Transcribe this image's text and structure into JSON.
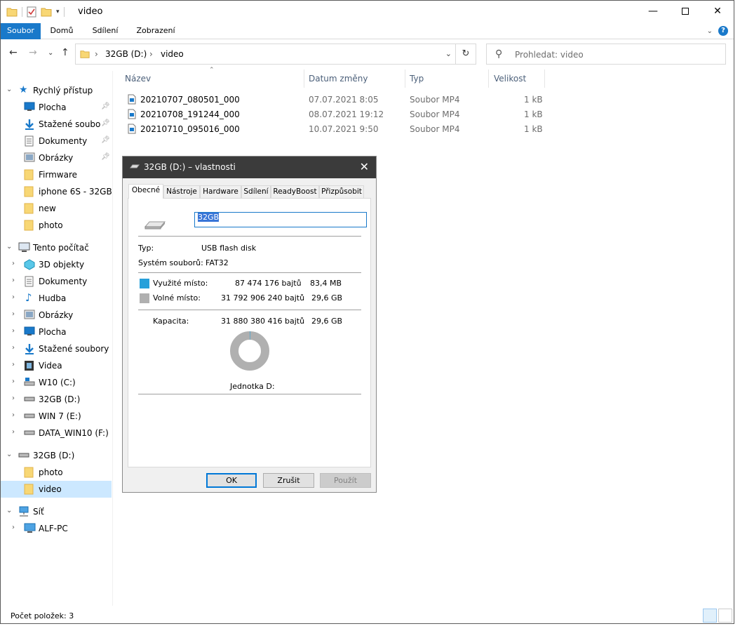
{
  "window": {
    "title": "video",
    "ribbon_tabs": [
      "Soubor",
      "Domů",
      "Sdílení",
      "Zobrazení"
    ]
  },
  "address": {
    "crumbs": [
      "32GB (D:)",
      "video"
    ]
  },
  "search": {
    "placeholder": "Prohledat: video"
  },
  "sidebar": {
    "quick_access": {
      "label": "Rychlý přístup",
      "items": [
        {
          "label": "Plocha",
          "icon": "desktop-icon",
          "pinned": true
        },
        {
          "label": "Stažené soubo",
          "icon": "download-icon",
          "pinned": true
        },
        {
          "label": "Dokumenty",
          "icon": "documents-icon",
          "pinned": true
        },
        {
          "label": "Obrázky",
          "icon": "pictures-icon",
          "pinned": true
        },
        {
          "label": "Firmware",
          "icon": "folder-icon",
          "pinned": false
        },
        {
          "label": "iphone 6S - 32GB",
          "icon": "folder-icon",
          "pinned": false
        },
        {
          "label": "new",
          "icon": "folder-icon",
          "pinned": false
        },
        {
          "label": "photo",
          "icon": "folder-icon",
          "pinned": false
        }
      ]
    },
    "this_pc": {
      "label": "Tento počítač",
      "items": [
        {
          "label": "3D objekty",
          "icon": "3d-objects-icon"
        },
        {
          "label": "Dokumenty",
          "icon": "documents-icon"
        },
        {
          "label": "Hudba",
          "icon": "music-icon"
        },
        {
          "label": "Obrázky",
          "icon": "pictures-icon"
        },
        {
          "label": "Plocha",
          "icon": "desktop-icon"
        },
        {
          "label": "Stažené soubory",
          "icon": "download-icon"
        },
        {
          "label": "Videa",
          "icon": "videos-icon"
        },
        {
          "label": "W10 (C:)",
          "icon": "system-drive-icon"
        },
        {
          "label": "32GB (D:)",
          "icon": "drive-icon"
        },
        {
          "label": "WIN 7 (E:)",
          "icon": "drive-icon"
        },
        {
          "label": "DATA_WIN10 (F:)",
          "icon": "drive-icon"
        }
      ]
    },
    "usb": {
      "label": "32GB (D:)",
      "items": [
        {
          "label": "photo",
          "icon": "folder-icon"
        },
        {
          "label": "video",
          "icon": "folder-icon"
        }
      ]
    },
    "network": {
      "label": "Síť",
      "items": [
        {
          "label": "ALF-PC",
          "icon": "computer-icon"
        }
      ]
    }
  },
  "files": {
    "columns": {
      "name": "Název",
      "date": "Datum změny",
      "type": "Typ",
      "size": "Velikost"
    },
    "rows": [
      {
        "name": "20210707_080501_000",
        "date": "07.07.2021 8:05",
        "type": "Soubor MP4",
        "size": "1 kB"
      },
      {
        "name": "20210708_191244_000",
        "date": "08.07.2021 19:12",
        "type": "Soubor MP4",
        "size": "1 kB"
      },
      {
        "name": "20210710_095016_000",
        "date": "10.07.2021 9:50",
        "type": "Soubor MP4",
        "size": "1 kB"
      }
    ]
  },
  "status": {
    "item_count": "Počet položek: 3"
  },
  "dialog": {
    "title": "32GB (D:) – vlastnosti",
    "tabs": [
      "Obecné",
      "Nástroje",
      "Hardware",
      "Sdílení",
      "ReadyBoost",
      "Přizpůsobit"
    ],
    "volume_name": "32GB",
    "type_label": "Typ:",
    "type_value": "USB flash disk",
    "fs_label": "Systém souborů:",
    "fs_value": "FAT32",
    "used_label": "Využité místo:",
    "used_bytes": "87 474 176 bajtů",
    "used_human": "83,4 MB",
    "free_label": "Volné místo:",
    "free_bytes": "31 792 906 240 bajtů",
    "free_human": "29,6 GB",
    "cap_label": "Kapacita:",
    "cap_bytes": "31 880 380 416 bajtů",
    "cap_human": "29,6 GB",
    "drive_caption": "Jednotka D:",
    "used_fraction": 0.0027,
    "colors": {
      "used": "#26a0da",
      "free": "#b0b0b0"
    },
    "buttons": {
      "ok": "OK",
      "cancel": "Zrušit",
      "apply": "Použít"
    }
  }
}
